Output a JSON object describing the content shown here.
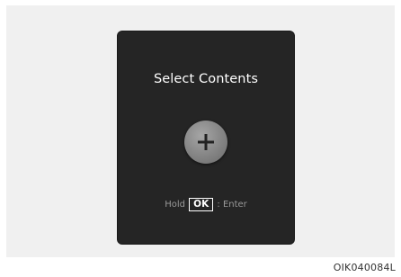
{
  "screen": {
    "title": "Select Contents",
    "add_button_symbol": "+",
    "hint": {
      "prefix": "Hold",
      "key": "OK",
      "suffix": ": Enter"
    }
  },
  "figure_code": "OIK040084L",
  "icons": {
    "add": "plus-icon"
  },
  "colors": {
    "screen_bg": "#252525",
    "backdrop": "#f0f0f0",
    "button": "#8a8a8a",
    "text": "#ffffff",
    "hint_text": "#9a9a9a"
  }
}
